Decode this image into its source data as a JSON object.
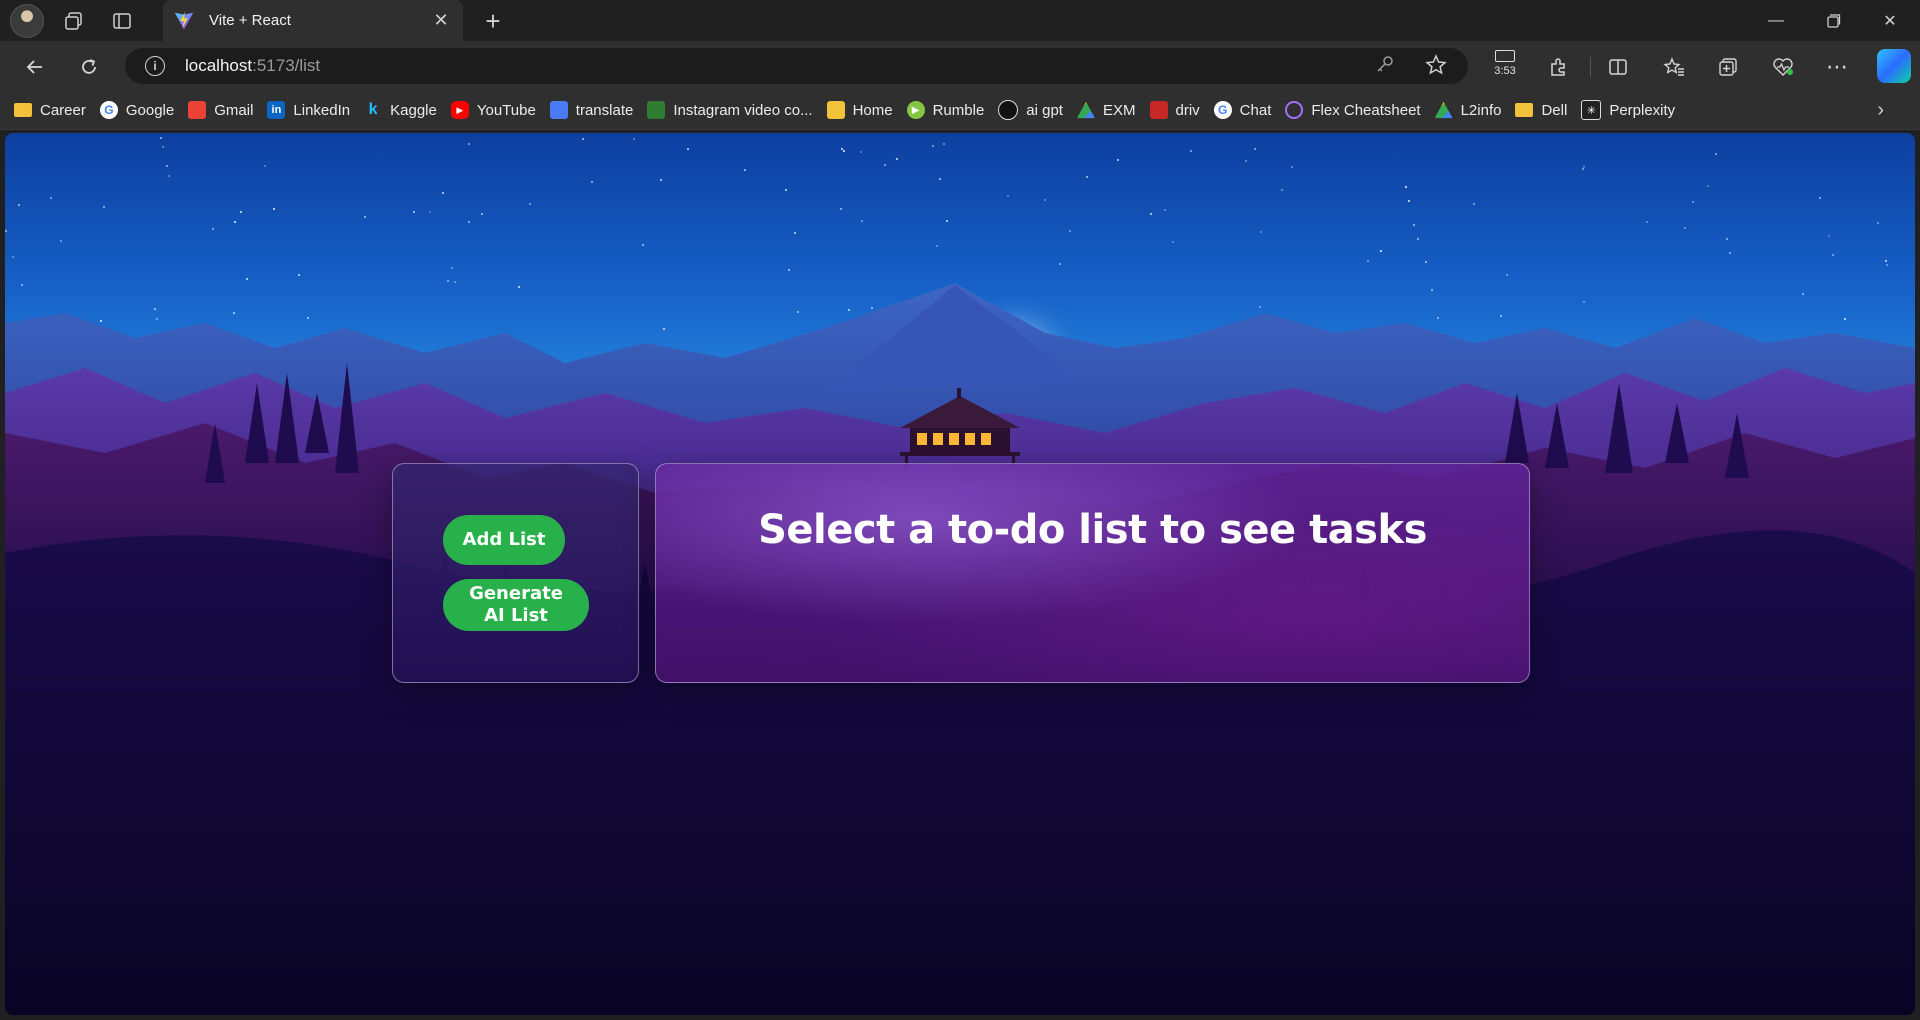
{
  "browser": {
    "tab": {
      "title": "Vite + React"
    },
    "address": {
      "host": "localhost",
      "rest": ":5173/list"
    },
    "clock": "3:53",
    "bookmarks": [
      {
        "label": "Career",
        "icon": "folder-icon",
        "color": "#f2c23a"
      },
      {
        "label": "Google",
        "icon": "google-icon",
        "color": "#4285f4"
      },
      {
        "label": "Gmail",
        "icon": "gmail-icon",
        "color": "#ea4335"
      },
      {
        "label": "LinkedIn",
        "icon": "linkedin-icon",
        "color": "#0a66c2"
      },
      {
        "label": "Kaggle",
        "icon": "kaggle-icon",
        "color": "#20beff"
      },
      {
        "label": "YouTube",
        "icon": "youtube-icon",
        "color": "#ff0000"
      },
      {
        "label": "translate",
        "icon": "translate-icon",
        "color": "#4a7bf5"
      },
      {
        "label": "Instagram video co...",
        "icon": "instagram-video-icon",
        "color": "#2e7d32"
      },
      {
        "label": "Home",
        "icon": "home-icon",
        "color": "#f2c23a"
      },
      {
        "label": "Rumble",
        "icon": "rumble-icon",
        "color": "#85c742"
      },
      {
        "label": "ai gpt",
        "icon": "openai-icon",
        "color": "#111111"
      },
      {
        "label": "EXM",
        "icon": "drive-icon",
        "color": "#34a853"
      },
      {
        "label": "driv",
        "icon": "driv-icon",
        "color": "#c62828"
      },
      {
        "label": "Chat",
        "icon": "google-icon",
        "color": "#4285f4"
      },
      {
        "label": "Flex Cheatsheet",
        "icon": "flex-icon",
        "color": "#a070ff"
      },
      {
        "label": "L2info",
        "icon": "drive-icon",
        "color": "#34a853"
      },
      {
        "label": "Dell",
        "icon": "folder-icon",
        "color": "#f2c23a"
      },
      {
        "label": "Perplexity",
        "icon": "perplexity-icon",
        "color": "#222222"
      }
    ]
  },
  "app": {
    "sidebar": {
      "add_list_label": "Add List",
      "generate_ai_label": "Generate\nAI List"
    },
    "main": {
      "title": "Select a to-do list to see tasks"
    },
    "colors": {
      "button_green": "#28b04a",
      "panel_purple": "#5a2490"
    }
  }
}
